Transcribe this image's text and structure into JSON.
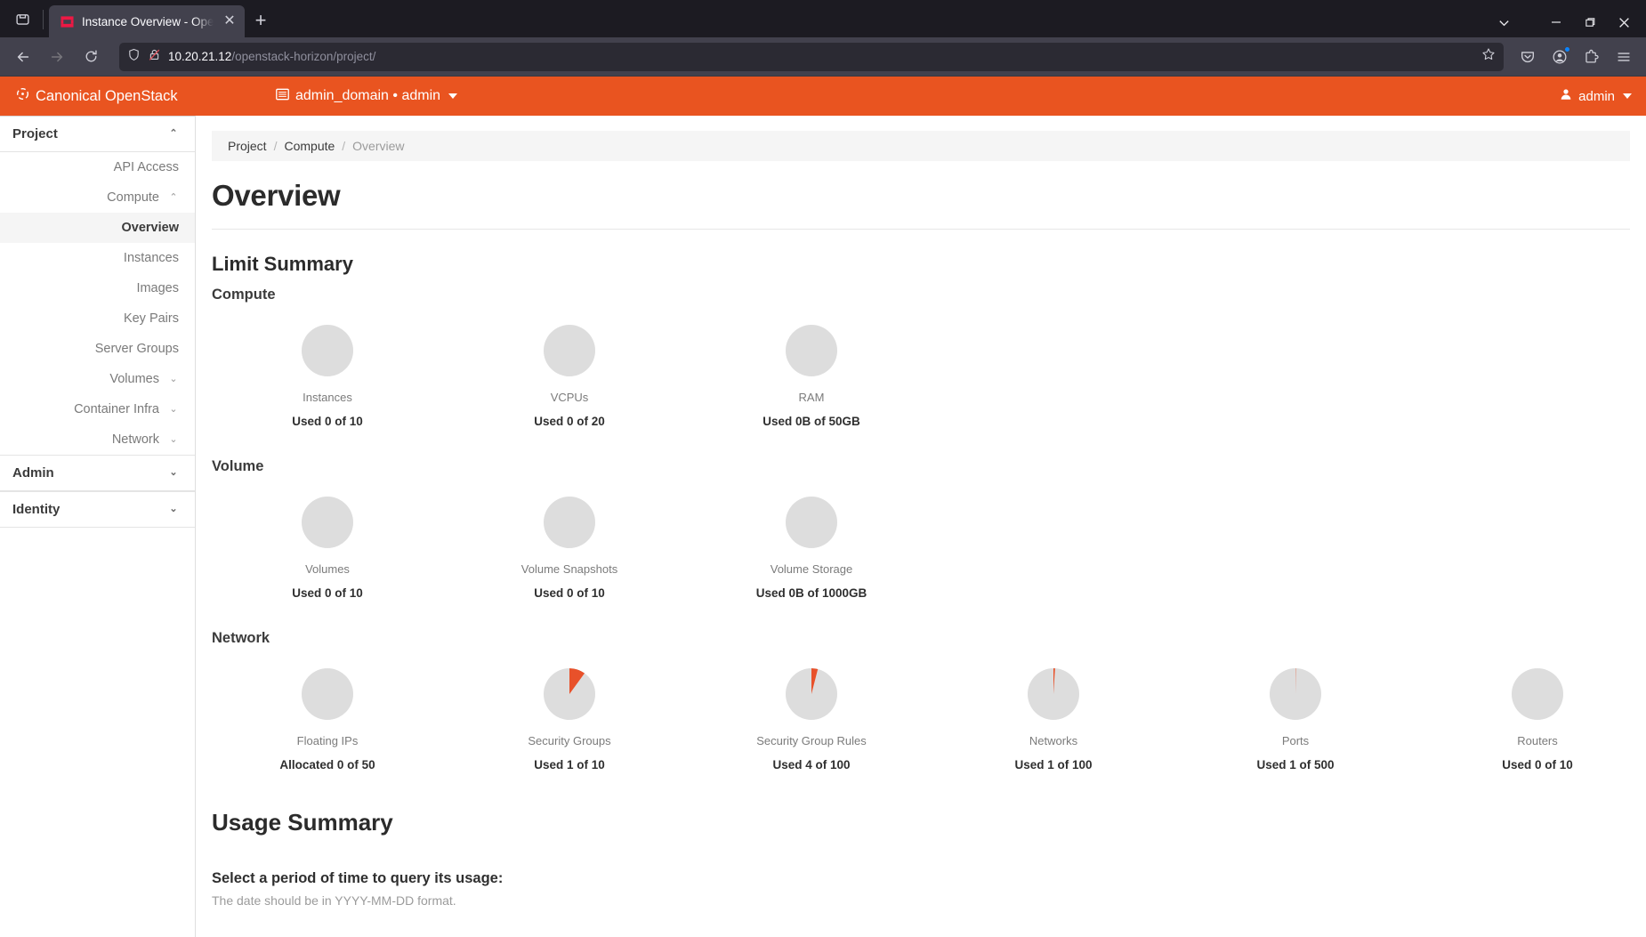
{
  "browser": {
    "tab": {
      "title": "Instance Overview - Open",
      "favicon_name": "openstack-favicon",
      "close_label": "✕"
    },
    "newtab_label": "+",
    "window_controls": {
      "list_all_tabs": "list-all-tabs-chevron",
      "minimize": "—",
      "restore": "restore",
      "close": "✕"
    },
    "nav": {
      "back": "back-arrow",
      "forward": "forward-arrow",
      "reload": "reload"
    },
    "url": {
      "host": "10.20.21.12",
      "path": "/openstack-horizon/project/",
      "shield_icon": "tracking-protection-shield",
      "lock_icon": "insecure-connection-lock",
      "bookmark_icon": "bookmark-star"
    },
    "toolbar_right": {
      "pocket": "pocket-icon",
      "account": "account-icon",
      "extensions": "extensions-icon",
      "menu": "hamburger-menu-icon"
    }
  },
  "os_header": {
    "brand": "Canonical OpenStack",
    "brand_icon": "canonical-circle-of-friends-icon",
    "context_icon": "domain-project-icon",
    "context": "admin_domain • admin",
    "user_icon": "user-icon",
    "user": "admin",
    "accent_color": "#e95420"
  },
  "sidebar": {
    "sections": [
      {
        "label": "Project",
        "chevron": "up",
        "type": "section",
        "items": [
          {
            "label": "API Access",
            "type": "link",
            "active": false
          },
          {
            "label": "Compute",
            "type": "group",
            "chevron": "up",
            "active": false
          },
          {
            "label": "Overview",
            "type": "link",
            "active": true
          },
          {
            "label": "Instances",
            "type": "link",
            "active": false
          },
          {
            "label": "Images",
            "type": "link",
            "active": false
          },
          {
            "label": "Key Pairs",
            "type": "link",
            "active": false
          },
          {
            "label": "Server Groups",
            "type": "link",
            "active": false
          },
          {
            "label": "Volumes",
            "type": "group",
            "chevron": "down",
            "active": false
          },
          {
            "label": "Container Infra",
            "type": "group",
            "chevron": "down",
            "active": false
          },
          {
            "label": "Network",
            "type": "group",
            "chevron": "down",
            "active": false
          }
        ]
      },
      {
        "label": "Admin",
        "chevron": "down",
        "type": "section",
        "items": []
      },
      {
        "label": "Identity",
        "chevron": "down",
        "type": "section",
        "items": []
      }
    ]
  },
  "main": {
    "breadcrumb": [
      "Project",
      "Compute",
      "Overview"
    ],
    "page_title": "Overview",
    "limit_summary_title": "Limit Summary",
    "usage_summary_title": "Usage Summary",
    "usage_prompt": "Select a period of time to query its usage:",
    "usage_hint": "The date should be in YYYY-MM-DD format.",
    "groups": [
      {
        "title": "Compute",
        "charts": [
          {
            "label": "Instances",
            "value": "Used 0 of 10",
            "used": 0,
            "total": 10,
            "percent": 0
          },
          {
            "label": "VCPUs",
            "value": "Used 0 of 20",
            "used": 0,
            "total": 20,
            "percent": 0
          },
          {
            "label": "RAM",
            "value": "Used 0B of 50GB",
            "used": 0,
            "total": 50,
            "percent": 0
          }
        ]
      },
      {
        "title": "Volume",
        "charts": [
          {
            "label": "Volumes",
            "value": "Used 0 of 10",
            "used": 0,
            "total": 10,
            "percent": 0
          },
          {
            "label": "Volume Snapshots",
            "value": "Used 0 of 10",
            "used": 0,
            "total": 10,
            "percent": 0
          },
          {
            "label": "Volume Storage",
            "value": "Used 0B of 1000GB",
            "used": 0,
            "total": 1000,
            "percent": 0
          }
        ]
      },
      {
        "title": "Network",
        "charts": [
          {
            "label": "Floating IPs",
            "value": "Allocated 0 of 50",
            "used": 0,
            "total": 50,
            "percent": 0
          },
          {
            "label": "Security Groups",
            "value": "Used 1 of 10",
            "used": 1,
            "total": 10,
            "percent": 10
          },
          {
            "label": "Security Group Rules",
            "value": "Used 4 of 100",
            "used": 4,
            "total": 100,
            "percent": 4
          },
          {
            "label": "Networks",
            "value": "Used 1 of 100",
            "used": 1,
            "total": 100,
            "percent": 1
          },
          {
            "label": "Ports",
            "value": "Used 1 of 500",
            "used": 1,
            "total": 500,
            "percent": 0.2
          },
          {
            "label": "Routers",
            "value": "Used 0 of 10",
            "used": 0,
            "total": 10,
            "percent": 0
          }
        ]
      }
    ]
  },
  "chart_data": {
    "type": "pie",
    "title": "Limit Summary",
    "legend": "none",
    "series": [
      {
        "name": "Instances",
        "group": "Compute",
        "used": 0,
        "total": 10,
        "percent": 0,
        "unit": "count"
      },
      {
        "name": "VCPUs",
        "group": "Compute",
        "used": 0,
        "total": 20,
        "percent": 0,
        "unit": "count"
      },
      {
        "name": "RAM",
        "group": "Compute",
        "used": 0,
        "total": 50,
        "percent": 0,
        "unit": "GB"
      },
      {
        "name": "Volumes",
        "group": "Volume",
        "used": 0,
        "total": 10,
        "percent": 0,
        "unit": "count"
      },
      {
        "name": "Volume Snapshots",
        "group": "Volume",
        "used": 0,
        "total": 10,
        "percent": 0,
        "unit": "count"
      },
      {
        "name": "Volume Storage",
        "group": "Volume",
        "used": 0,
        "total": 1000,
        "percent": 0,
        "unit": "GB"
      },
      {
        "name": "Floating IPs",
        "group": "Network",
        "used": 0,
        "total": 50,
        "percent": 0,
        "unit": "count"
      },
      {
        "name": "Security Groups",
        "group": "Network",
        "used": 1,
        "total": 10,
        "percent": 10,
        "unit": "count"
      },
      {
        "name": "Security Group Rules",
        "group": "Network",
        "used": 4,
        "total": 100,
        "percent": 4,
        "unit": "count"
      },
      {
        "name": "Networks",
        "group": "Network",
        "used": 1,
        "total": 100,
        "percent": 1,
        "unit": "count"
      },
      {
        "name": "Ports",
        "group": "Network",
        "used": 1,
        "total": 500,
        "percent": 0.2,
        "unit": "count"
      },
      {
        "name": "Routers",
        "group": "Network",
        "used": 0,
        "total": 10,
        "percent": 0,
        "unit": "count"
      }
    ],
    "colors": {
      "used": "#e8512a",
      "free": "#dddddd"
    }
  }
}
